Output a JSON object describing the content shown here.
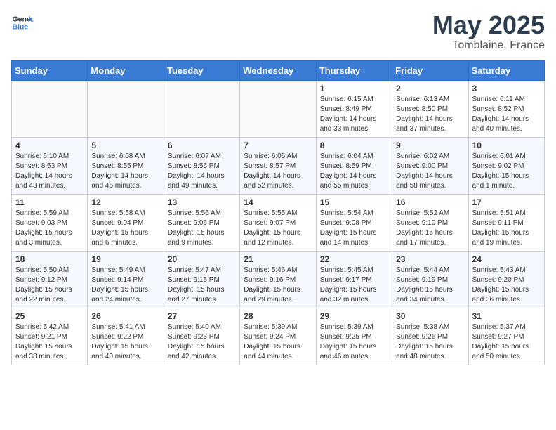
{
  "header": {
    "logo_line1": "General",
    "logo_line2": "Blue",
    "title": "May 2025",
    "subtitle": "Tomblaine, France"
  },
  "days_of_week": [
    "Sunday",
    "Monday",
    "Tuesday",
    "Wednesday",
    "Thursday",
    "Friday",
    "Saturday"
  ],
  "weeks": [
    [
      {
        "day": "",
        "info": ""
      },
      {
        "day": "",
        "info": ""
      },
      {
        "day": "",
        "info": ""
      },
      {
        "day": "",
        "info": ""
      },
      {
        "day": "1",
        "info": "Sunrise: 6:15 AM\nSunset: 8:49 PM\nDaylight: 14 hours and 33 minutes."
      },
      {
        "day": "2",
        "info": "Sunrise: 6:13 AM\nSunset: 8:50 PM\nDaylight: 14 hours and 37 minutes."
      },
      {
        "day": "3",
        "info": "Sunrise: 6:11 AM\nSunset: 8:52 PM\nDaylight: 14 hours and 40 minutes."
      }
    ],
    [
      {
        "day": "4",
        "info": "Sunrise: 6:10 AM\nSunset: 8:53 PM\nDaylight: 14 hours and 43 minutes."
      },
      {
        "day": "5",
        "info": "Sunrise: 6:08 AM\nSunset: 8:55 PM\nDaylight: 14 hours and 46 minutes."
      },
      {
        "day": "6",
        "info": "Sunrise: 6:07 AM\nSunset: 8:56 PM\nDaylight: 14 hours and 49 minutes."
      },
      {
        "day": "7",
        "info": "Sunrise: 6:05 AM\nSunset: 8:57 PM\nDaylight: 14 hours and 52 minutes."
      },
      {
        "day": "8",
        "info": "Sunrise: 6:04 AM\nSunset: 8:59 PM\nDaylight: 14 hours and 55 minutes."
      },
      {
        "day": "9",
        "info": "Sunrise: 6:02 AM\nSunset: 9:00 PM\nDaylight: 14 hours and 58 minutes."
      },
      {
        "day": "10",
        "info": "Sunrise: 6:01 AM\nSunset: 9:02 PM\nDaylight: 15 hours and 1 minute."
      }
    ],
    [
      {
        "day": "11",
        "info": "Sunrise: 5:59 AM\nSunset: 9:03 PM\nDaylight: 15 hours and 3 minutes."
      },
      {
        "day": "12",
        "info": "Sunrise: 5:58 AM\nSunset: 9:04 PM\nDaylight: 15 hours and 6 minutes."
      },
      {
        "day": "13",
        "info": "Sunrise: 5:56 AM\nSunset: 9:06 PM\nDaylight: 15 hours and 9 minutes."
      },
      {
        "day": "14",
        "info": "Sunrise: 5:55 AM\nSunset: 9:07 PM\nDaylight: 15 hours and 12 minutes."
      },
      {
        "day": "15",
        "info": "Sunrise: 5:54 AM\nSunset: 9:08 PM\nDaylight: 15 hours and 14 minutes."
      },
      {
        "day": "16",
        "info": "Sunrise: 5:52 AM\nSunset: 9:10 PM\nDaylight: 15 hours and 17 minutes."
      },
      {
        "day": "17",
        "info": "Sunrise: 5:51 AM\nSunset: 9:11 PM\nDaylight: 15 hours and 19 minutes."
      }
    ],
    [
      {
        "day": "18",
        "info": "Sunrise: 5:50 AM\nSunset: 9:12 PM\nDaylight: 15 hours and 22 minutes."
      },
      {
        "day": "19",
        "info": "Sunrise: 5:49 AM\nSunset: 9:14 PM\nDaylight: 15 hours and 24 minutes."
      },
      {
        "day": "20",
        "info": "Sunrise: 5:47 AM\nSunset: 9:15 PM\nDaylight: 15 hours and 27 minutes."
      },
      {
        "day": "21",
        "info": "Sunrise: 5:46 AM\nSunset: 9:16 PM\nDaylight: 15 hours and 29 minutes."
      },
      {
        "day": "22",
        "info": "Sunrise: 5:45 AM\nSunset: 9:17 PM\nDaylight: 15 hours and 32 minutes."
      },
      {
        "day": "23",
        "info": "Sunrise: 5:44 AM\nSunset: 9:19 PM\nDaylight: 15 hours and 34 minutes."
      },
      {
        "day": "24",
        "info": "Sunrise: 5:43 AM\nSunset: 9:20 PM\nDaylight: 15 hours and 36 minutes."
      }
    ],
    [
      {
        "day": "25",
        "info": "Sunrise: 5:42 AM\nSunset: 9:21 PM\nDaylight: 15 hours and 38 minutes."
      },
      {
        "day": "26",
        "info": "Sunrise: 5:41 AM\nSunset: 9:22 PM\nDaylight: 15 hours and 40 minutes."
      },
      {
        "day": "27",
        "info": "Sunrise: 5:40 AM\nSunset: 9:23 PM\nDaylight: 15 hours and 42 minutes."
      },
      {
        "day": "28",
        "info": "Sunrise: 5:39 AM\nSunset: 9:24 PM\nDaylight: 15 hours and 44 minutes."
      },
      {
        "day": "29",
        "info": "Sunrise: 5:39 AM\nSunset: 9:25 PM\nDaylight: 15 hours and 46 minutes."
      },
      {
        "day": "30",
        "info": "Sunrise: 5:38 AM\nSunset: 9:26 PM\nDaylight: 15 hours and 48 minutes."
      },
      {
        "day": "31",
        "info": "Sunrise: 5:37 AM\nSunset: 9:27 PM\nDaylight: 15 hours and 50 minutes."
      }
    ]
  ]
}
